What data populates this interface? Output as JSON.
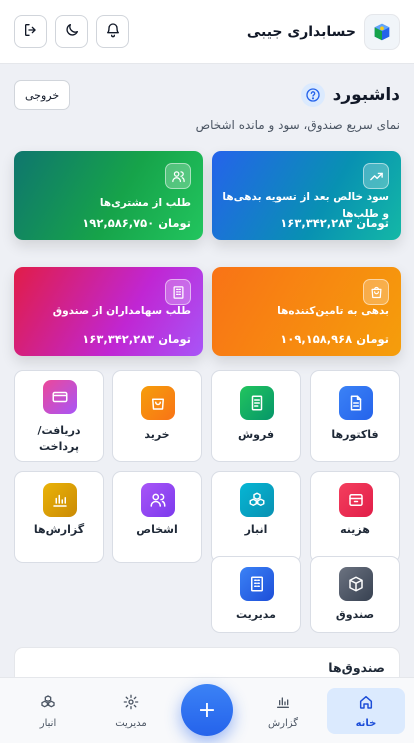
{
  "header": {
    "app_title": "حسابداری جیبی",
    "buttons": [
      "bell-icon",
      "moon-icon",
      "logout-icon"
    ]
  },
  "dashboard": {
    "title": "داشبورد",
    "exit_label": "خروجی",
    "subtitle": "نمای سریع صندوق، سود و مانده اشخاص"
  },
  "stats": [
    {
      "label": "سود خالص بعد از تسویه بدهی‌ها و طلب‌ها",
      "value": "تومان ۱۶۳,۳۴۲,۲۸۳",
      "icon": "trend-up-icon",
      "color": "#2563eb"
    },
    {
      "label": "طلب از مشتری‌ها",
      "value": "تومان ۱۹۲,۵۸۶,۷۵۰",
      "icon": "users-icon",
      "color": "#16a34a"
    },
    {
      "label": "بدهی به تامین‌کننده‌ها",
      "value": "تومان ۱۰۹,۱۵۸,۹۶۸",
      "icon": "bag-icon",
      "color": "#f97316"
    },
    {
      "label": "طلب سهامداران از صندوق",
      "value": "تومان ۱۶۳,۳۴۲,۲۸۳",
      "icon": "building-icon",
      "color": "#c026d3"
    }
  ],
  "tiles": [
    {
      "label": "فاکتورها",
      "icon": "invoice-icon"
    },
    {
      "label": "فروش",
      "icon": "receipt-icon"
    },
    {
      "label": "خرید",
      "icon": "shopping-bag-icon"
    },
    {
      "label": "دریافت/ پرداخت",
      "icon": "card-icon"
    },
    {
      "label": "هزینه",
      "icon": "wallet-icon"
    },
    {
      "label": "انبار",
      "icon": "boxes-icon"
    },
    {
      "label": "اشخاص",
      "icon": "people-icon"
    },
    {
      "label": "گزارش‌ها",
      "icon": "chart-icon"
    },
    {
      "label": "صندوق",
      "icon": "cube-icon"
    },
    {
      "label": "مدیریت",
      "icon": "office-icon"
    }
  ],
  "funds": {
    "title": "صندوق‌ها"
  },
  "bottom_nav": [
    {
      "label": "خانه",
      "icon": "home-icon",
      "active": true
    },
    {
      "label": "گزارش",
      "icon": "bar-chart-icon",
      "active": false
    },
    {
      "label": "مدیریت",
      "icon": "gear-icon",
      "active": false
    },
    {
      "label": "انبار",
      "icon": "boxes-icon",
      "active": false
    }
  ],
  "fab": {
    "label": "+"
  }
}
